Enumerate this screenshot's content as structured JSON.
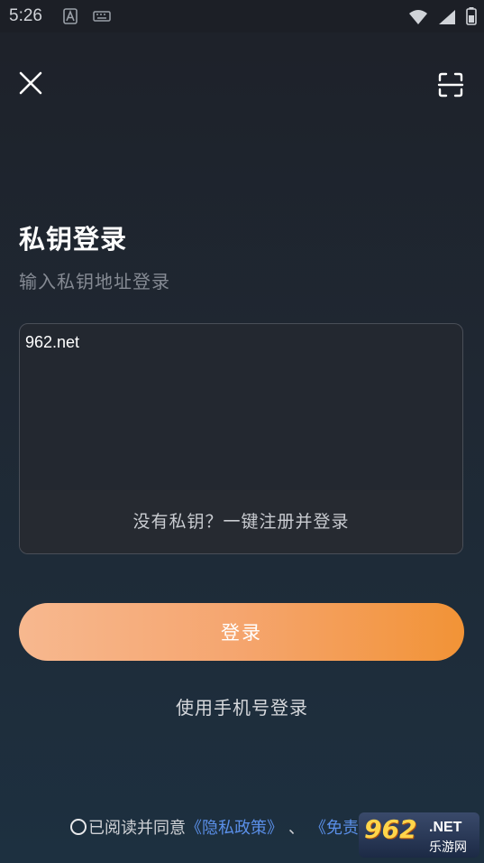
{
  "status_bar": {
    "time": "5:26",
    "left_icons": [
      "font-a-icon",
      "keyboard-icon"
    ],
    "right_icons": [
      "wifi-icon",
      "signal-icon",
      "battery-icon"
    ]
  },
  "header": {
    "close_icon": "close-icon",
    "scan_icon": "scan-icon"
  },
  "main": {
    "title": "私钥登录",
    "subtitle": "输入私钥地址登录",
    "key_input_value": "962.net",
    "register_link": "没有私钥？一键注册并登录",
    "login_button": "登录",
    "phone_login": "使用手机号登录"
  },
  "agreement": {
    "prefix": "已阅读并同意",
    "privacy_link": "《隐私政策》",
    "separator": "、",
    "disclaimer_link": "《免责"
  },
  "watermark": {
    "logo": "962",
    "suffix": ".NET",
    "sub": "乐游网"
  },
  "colors": {
    "accent_start": "#f7b88f",
    "accent_end": "#f29336",
    "link": "#5a8fe8",
    "background": "#1f2833"
  }
}
